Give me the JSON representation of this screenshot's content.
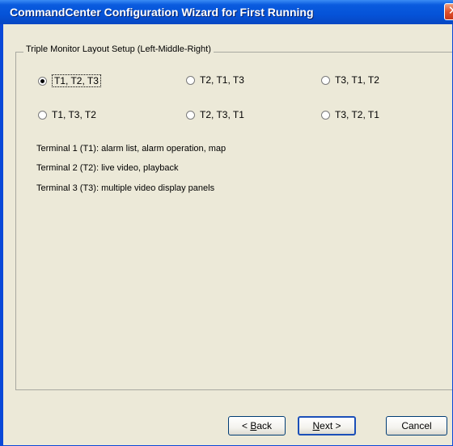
{
  "window": {
    "title": "CommandCenter Configuration Wizard for First Running",
    "close_glyph": "✕"
  },
  "groupbox": {
    "label": "Triple Monitor Layout Setup (Left-Middle-Right)"
  },
  "layout_options": [
    {
      "label": "T1, T2, T3",
      "checked": true
    },
    {
      "label": "T2, T1, T3",
      "checked": false
    },
    {
      "label": "T3, T1, T2",
      "checked": false
    },
    {
      "label": "T1, T3, T2",
      "checked": false
    },
    {
      "label": "T2, T3, T1",
      "checked": false
    },
    {
      "label": "T3, T2, T1",
      "checked": false
    }
  ],
  "descriptions": [
    "Terminal 1 (T1): alarm list, alarm operation, map",
    "Terminal 2 (T2): live video, playback",
    "Terminal 3 (T3): multiple video display panels"
  ],
  "buttons": {
    "back_prefix": "< ",
    "back_mnemonic": "B",
    "back_rest": "ack",
    "next_mnemonic": "N",
    "next_rest": "ext >",
    "cancel": "Cancel"
  },
  "colors": {
    "titlebar": "#0553d8",
    "dialog_bg": "#ece9d8",
    "close_button": "#e0512b"
  },
  "icons": {
    "close": "close-icon"
  }
}
